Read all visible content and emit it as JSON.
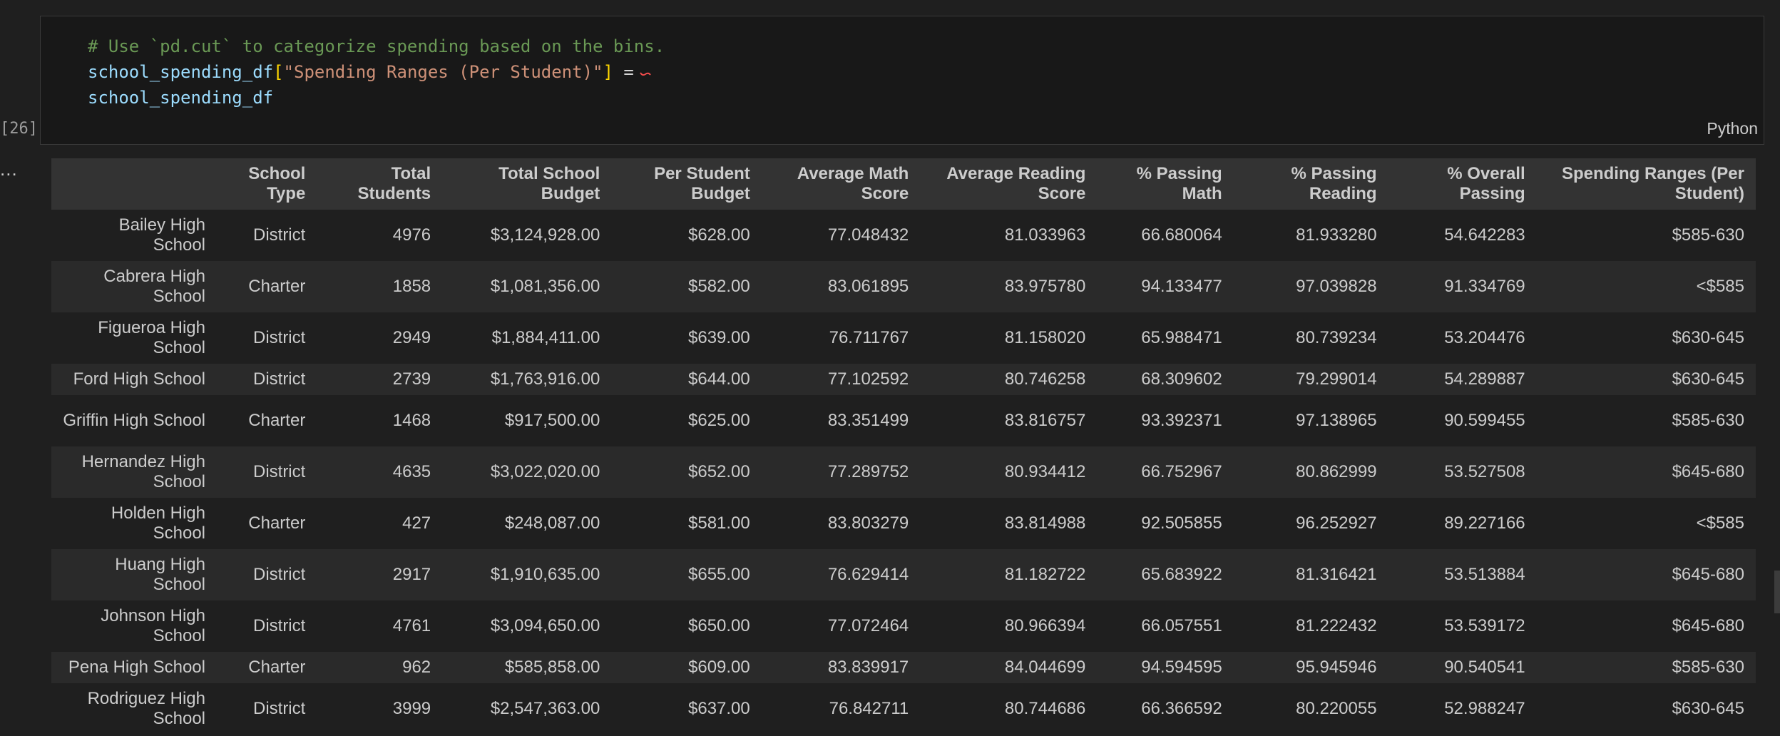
{
  "cell": {
    "execution_count": "[26]",
    "language": "Python",
    "code_lines": [
      [
        {
          "t": "comment",
          "v": "# Use `pd.cut` to categorize spending based on the bins."
        }
      ],
      [
        {
          "t": "var",
          "v": "school_spending_df"
        },
        {
          "t": "bracket",
          "v": "["
        },
        {
          "t": "string",
          "v": "\"Spending Ranges (Per Student)\""
        },
        {
          "t": "bracket",
          "v": "]"
        },
        {
          "t": "punct",
          "v": " ="
        }
      ],
      [
        {
          "t": "var",
          "v": "school_spending_df"
        }
      ]
    ]
  },
  "output": {
    "ellipsis": "...",
    "columns": [
      "",
      "School Type",
      "Total Students",
      "Total School Budget",
      "Per Student Budget",
      "Average Math Score",
      "Average Reading Score",
      "% Passing Math",
      "% Passing Reading",
      "% Overall Passing",
      "Spending Ranges (Per Student)"
    ],
    "rows": [
      [
        "Bailey High School",
        "District",
        "4976",
        "$3,124,928.00",
        "$628.00",
        "77.048432",
        "81.033963",
        "66.680064",
        "81.933280",
        "54.642283",
        "$585-630"
      ],
      [
        "Cabrera High School",
        "Charter",
        "1858",
        "$1,081,356.00",
        "$582.00",
        "83.061895",
        "83.975780",
        "94.133477",
        "97.039828",
        "91.334769",
        "<$585"
      ],
      [
        "Figueroa High School",
        "District",
        "2949",
        "$1,884,411.00",
        "$639.00",
        "76.711767",
        "81.158020",
        "65.988471",
        "80.739234",
        "53.204476",
        "$630-645"
      ],
      [
        "Ford High School",
        "District",
        "2739",
        "$1,763,916.00",
        "$644.00",
        "77.102592",
        "80.746258",
        "68.309602",
        "79.299014",
        "54.289887",
        "$630-645"
      ],
      [
        "Griffin High School",
        "Charter",
        "1468",
        "$917,500.00",
        "$625.00",
        "83.351499",
        "83.816757",
        "93.392371",
        "97.138965",
        "90.599455",
        "$585-630"
      ],
      [
        "Hernandez High School",
        "District",
        "4635",
        "$3,022,020.00",
        "$652.00",
        "77.289752",
        "80.934412",
        "66.752967",
        "80.862999",
        "53.527508",
        "$645-680"
      ],
      [
        "Holden High School",
        "Charter",
        "427",
        "$248,087.00",
        "$581.00",
        "83.803279",
        "83.814988",
        "92.505855",
        "96.252927",
        "89.227166",
        "<$585"
      ],
      [
        "Huang High School",
        "District",
        "2917",
        "$1,910,635.00",
        "$655.00",
        "76.629414",
        "81.182722",
        "65.683922",
        "81.316421",
        "53.513884",
        "$645-680"
      ],
      [
        "Johnson High School",
        "District",
        "4761",
        "$3,094,650.00",
        "$650.00",
        "77.072464",
        "80.966394",
        "66.057551",
        "81.222432",
        "53.539172",
        "$645-680"
      ],
      [
        "Pena High School",
        "Charter",
        "962",
        "$585,858.00",
        "$609.00",
        "83.839917",
        "84.044699",
        "94.594595",
        "95.945946",
        "90.540541",
        "$585-630"
      ],
      [
        "Rodriguez High School",
        "District",
        "3999",
        "$2,547,363.00",
        "$637.00",
        "76.842711",
        "80.744686",
        "66.366592",
        "80.220055",
        "52.988247",
        "$630-645"
      ]
    ]
  },
  "colors": {
    "background": "#1f1f1f",
    "cell_background": "#181818",
    "header_background": "#333333",
    "stripe": "#2a2a2a",
    "comment": "#6a9955",
    "variable": "#9cdcfe",
    "string": "#ce9178",
    "bracket": "#ffd700"
  }
}
